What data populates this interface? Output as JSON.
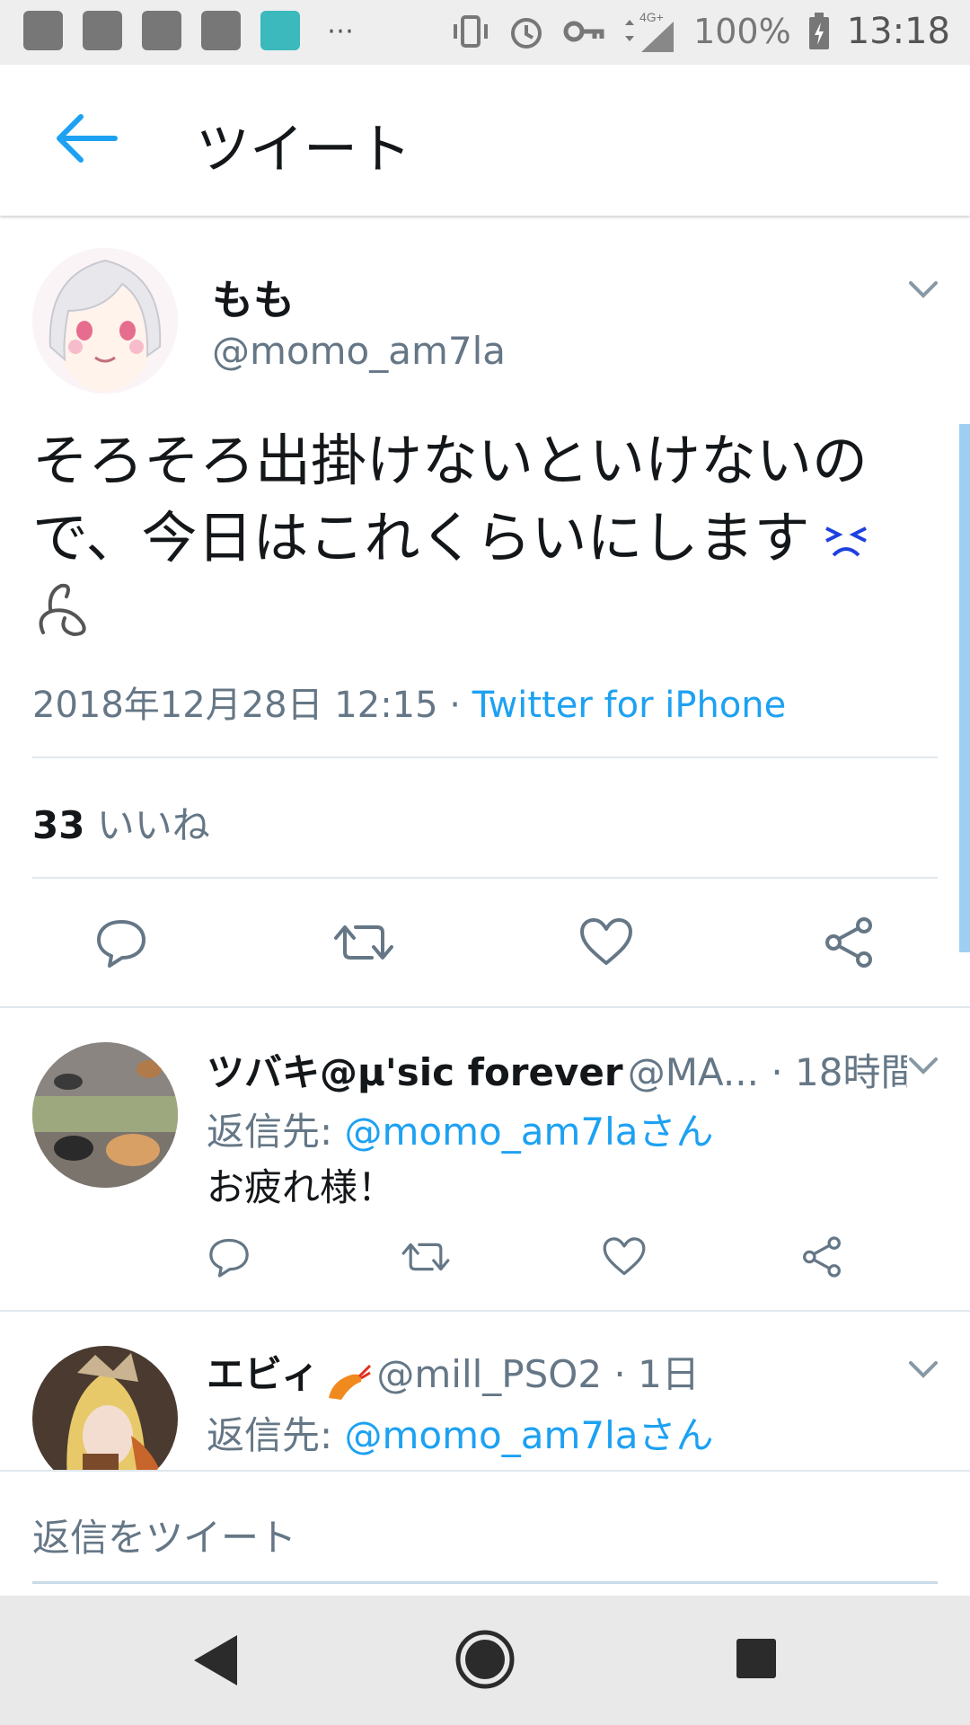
{
  "status_bar": {
    "battery_percent": "100%",
    "time": "13:18",
    "network": "4G+"
  },
  "app_bar": {
    "title": "ツイート"
  },
  "tweet": {
    "author_name": "もも",
    "author_handle": "@momo_am7la",
    "text_line1": "そろそろ出掛けないといけないの",
    "text_line2": "で、今日はこれくらいにします",
    "timestamp": "2018年12月28日 12:15 · ",
    "via": "Twitter for iPhone",
    "likes_count": "33",
    "likes_label": " いいね"
  },
  "replies": [
    {
      "name": "ツバキ@μ'sic forever",
      "handle": "@MA... · 18時間",
      "reply_to_label": "返信先: ",
      "reply_to_link": "@momo_am7laさん",
      "text": "お疲れ様！"
    },
    {
      "name": "エビィ",
      "handle": "@mill_PSO2 · 1日",
      "reply_to_label": "返信先: ",
      "reply_to_link": "@momo_am7laさん"
    }
  ],
  "compose": {
    "placeholder": "返信をツイート"
  },
  "colors": {
    "accent": "#1da1f2",
    "secondary_text": "#657786",
    "divider": "#e1e8ed"
  }
}
